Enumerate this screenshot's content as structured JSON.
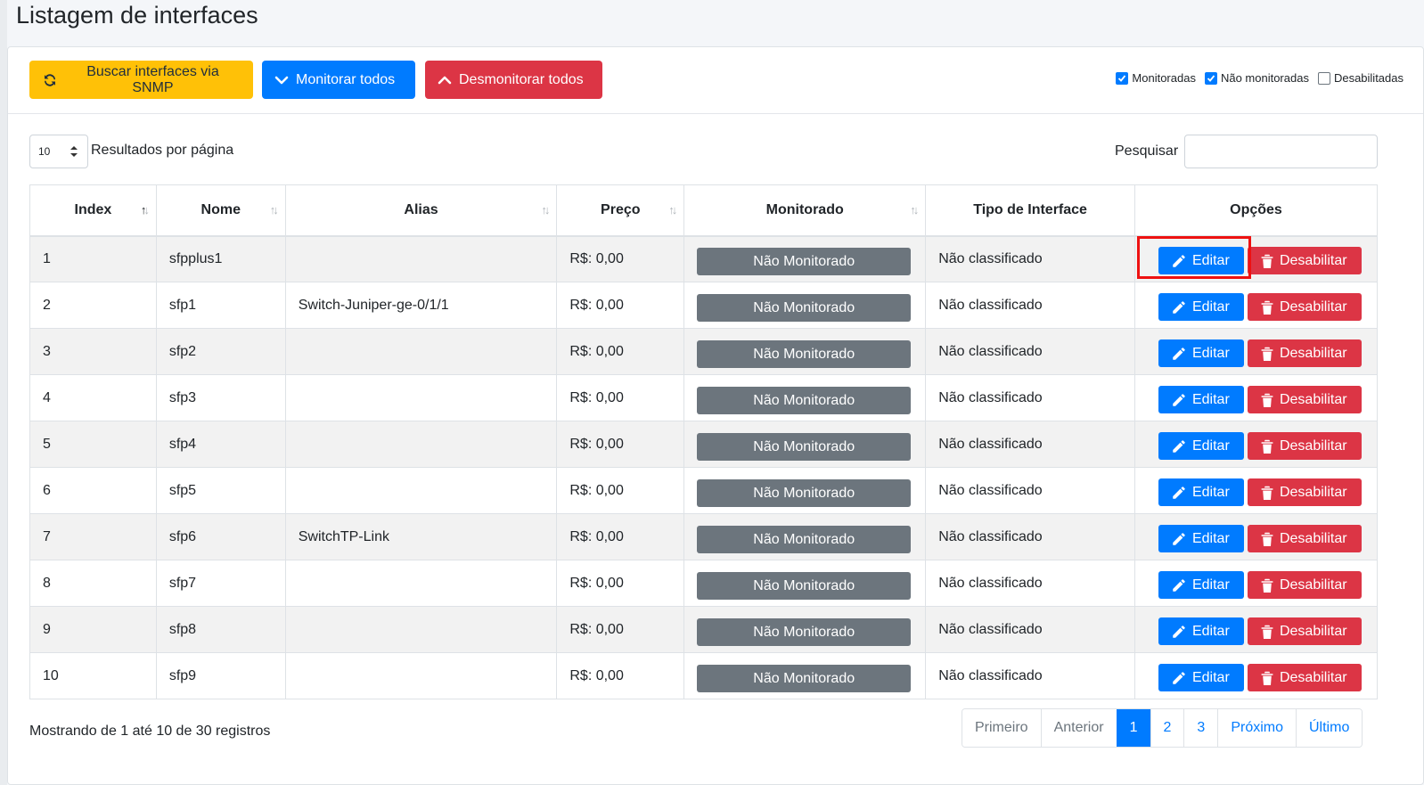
{
  "page": {
    "title": "Listagem de interfaces"
  },
  "toolbar": {
    "snmp_label": "Buscar interfaces via SNMP",
    "monitor_all_label": "Monitorar todos",
    "unmonitor_all_label": "Desmonitorar todos"
  },
  "filters": [
    {
      "label": "Monitoradas",
      "checked": true
    },
    {
      "label": "Não monitoradas",
      "checked": true
    },
    {
      "label": "Desabilitadas",
      "checked": false
    }
  ],
  "length": {
    "value": "10",
    "label": "Resultados por página"
  },
  "search": {
    "label": "Pesquisar",
    "value": ""
  },
  "table": {
    "headers": [
      "Index",
      "Nome",
      "Alias",
      "Preço",
      "Monitorado",
      "Tipo de Interface",
      "Opções"
    ],
    "rows": [
      {
        "index": "1",
        "nome": "sfpplus1",
        "alias": "",
        "preco": "R$: 0,00",
        "monitorado": "Não Monitorado",
        "tipo": "Não classificado"
      },
      {
        "index": "2",
        "nome": "sfp1",
        "alias": "Switch-Juniper-ge-0/1/1",
        "preco": "R$: 0,00",
        "monitorado": "Não Monitorado",
        "tipo": "Não classificado"
      },
      {
        "index": "3",
        "nome": "sfp2",
        "alias": "",
        "preco": "R$: 0,00",
        "monitorado": "Não Monitorado",
        "tipo": "Não classificado"
      },
      {
        "index": "4",
        "nome": "sfp3",
        "alias": "",
        "preco": "R$: 0,00",
        "monitorado": "Não Monitorado",
        "tipo": "Não classificado"
      },
      {
        "index": "5",
        "nome": "sfp4",
        "alias": "",
        "preco": "R$: 0,00",
        "monitorado": "Não Monitorado",
        "tipo": "Não classificado"
      },
      {
        "index": "6",
        "nome": "sfp5",
        "alias": "",
        "preco": "R$: 0,00",
        "monitorado": "Não Monitorado",
        "tipo": "Não classificado"
      },
      {
        "index": "7",
        "nome": "sfp6",
        "alias": "SwitchTP-Link",
        "preco": "R$: 0,00",
        "monitorado": "Não Monitorado",
        "tipo": "Não classificado"
      },
      {
        "index": "8",
        "nome": "sfp7",
        "alias": "",
        "preco": "R$: 0,00",
        "monitorado": "Não Monitorado",
        "tipo": "Não classificado"
      },
      {
        "index": "9",
        "nome": "sfp8",
        "alias": "",
        "preco": "R$: 0,00",
        "monitorado": "Não Monitorado",
        "tipo": "Não classificado"
      },
      {
        "index": "10",
        "nome": "sfp9",
        "alias": "",
        "preco": "R$: 0,00",
        "monitorado": "Não Monitorado",
        "tipo": "Não classificado"
      }
    ],
    "edit_label": "Editar",
    "disable_label": "Desabilitar"
  },
  "footer": {
    "info": "Mostrando de 1 até 10 de 30 registros",
    "pagination": {
      "first": "Primeiro",
      "previous": "Anterior",
      "pages": [
        "1",
        "2",
        "3"
      ],
      "active_page": "1",
      "next": "Próximo",
      "last": "Último"
    }
  },
  "colors": {
    "primary": "#007bff",
    "danger": "#dc3545",
    "warning": "#ffc107",
    "secondary": "#6c757d",
    "highlight": "#ee1111"
  },
  "icons": {
    "snmp": "sync-icon",
    "monitor_all": "chevron-down-icon",
    "unmonitor_all": "chevron-up-icon",
    "edit": "pencil-icon",
    "disable": "trash-icon"
  }
}
